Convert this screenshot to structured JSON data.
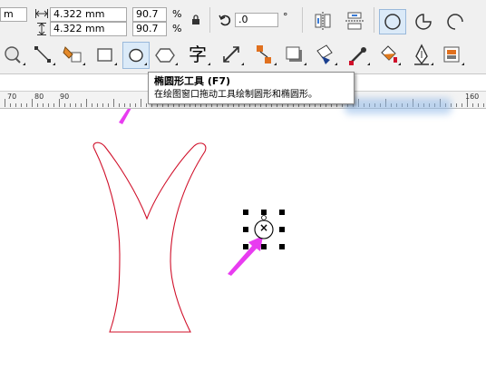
{
  "property_bar": {
    "x_value": "m",
    "width_value": "4.322 mm",
    "height_value": "4.322 mm",
    "scale_x": "90.7",
    "scale_y": "90.7",
    "percent_x": "%",
    "percent_y": "%",
    "rotation_value": ".0",
    "degree_symbol": "°"
  },
  "toolbar": {
    "tools": [
      {
        "name": "zoom-tool"
      },
      {
        "name": "connector-tool"
      },
      {
        "name": "smart-fill-tool"
      },
      {
        "name": "rectangle-tool"
      },
      {
        "name": "ellipse-tool"
      },
      {
        "name": "polygon-tool"
      },
      {
        "name": "text-tool"
      },
      {
        "name": "dimension-tool"
      },
      {
        "name": "interactive-tool"
      },
      {
        "name": "drop-shadow-tool"
      },
      {
        "name": "fill-tool"
      },
      {
        "name": "eyedropper-tool"
      },
      {
        "name": "paintbucket-tool"
      },
      {
        "name": "outline-pen-tool"
      },
      {
        "name": "transparency-tool"
      }
    ],
    "text_tool_glyph": "字"
  },
  "ruler": {
    "labels": [
      "70",
      "80",
      "90",
      "160"
    ]
  },
  "tooltip": {
    "title": "椭圆形工具 (F7)",
    "description": "在绘图窗口拖动工具绘制圆形和椭圆形。"
  },
  "canvas": {
    "selected_marker": "×"
  },
  "colors": {
    "outline_red": "#d0102a",
    "arrow_magenta": "#e83cf0",
    "watermark_blue": "#8fb8e8"
  }
}
